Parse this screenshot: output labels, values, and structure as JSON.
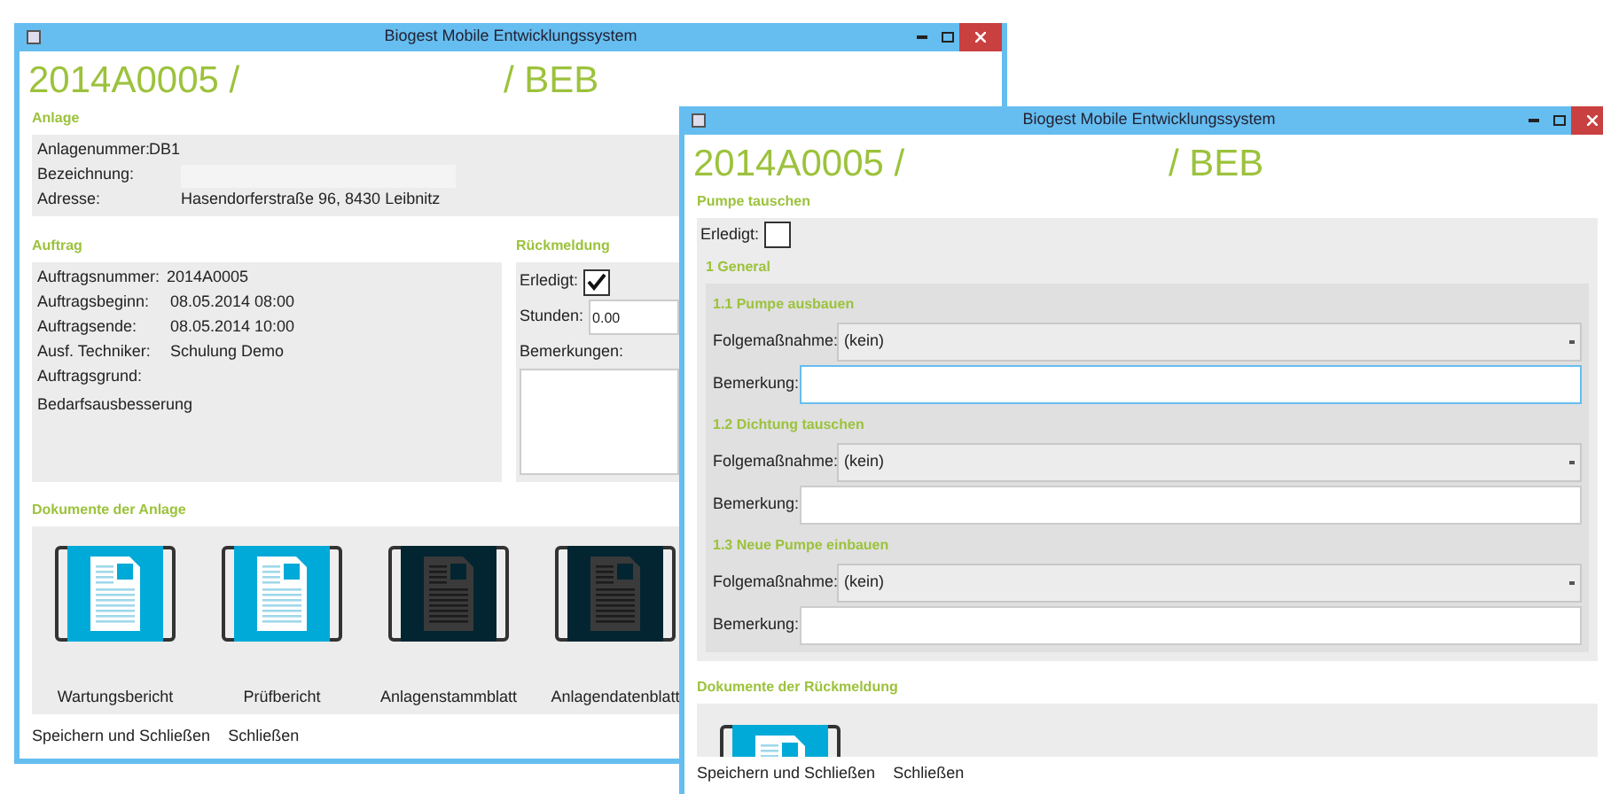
{
  "main_window": {
    "title": "Biogest Mobile Entwicklungssystem",
    "heading_left": "2014A0005 /",
    "heading_right": "/ BEB",
    "anlage": {
      "label": "Anlage",
      "rows": [
        {
          "label": "Anlagenummer:",
          "value": "DB1"
        },
        {
          "label": "Bezeichnung:"
        },
        {
          "label": "Adresse:",
          "value": "Hasendorferstraße 96, 8430 Leibnitz"
        }
      ]
    },
    "auftrag": {
      "label": "Auftrag",
      "rows": [
        {
          "label": "Auftragsnummer:",
          "value": "2014A0005"
        },
        {
          "label": "Auftragsbeginn:",
          "value": "08.05.2014 08:00"
        },
        {
          "label": "Auftragsende:",
          "value": "08.05.2014 10:00"
        },
        {
          "label": "Ausf. Techniker:",
          "value": "Schulung Demo"
        },
        {
          "label": "Auftragsgrund:"
        }
      ],
      "note": "Bedarfsausbesserung"
    },
    "rueckmeldung": {
      "label": "Rückmeldung",
      "done_label": "Erledigt:",
      "checked": true,
      "hours_label": "Stunden:",
      "hours_value": "0.00",
      "remarks_label": "Bemerkungen:"
    },
    "documents": {
      "label": "Dokumente der Anlage",
      "items": [
        {
          "name": "Wartungsbericht",
          "kind": "blue"
        },
        {
          "name": "Prüfbericht",
          "kind": "blue"
        },
        {
          "name": "Anlagenstammblatt",
          "kind": "dark"
        },
        {
          "name": "Anlagendatenblatt",
          "kind": "dark"
        }
      ]
    },
    "footer_buttons": [
      "Speichern und Schließen",
      "Schließen"
    ]
  },
  "detail_window": {
    "title": "Biogest Mobile Entwicklungssystem",
    "heading_left": "2014A0005 /",
    "heading_right": "/ BEB",
    "task": {
      "label": "Pumpe tauschen",
      "done_label": "Erledigt:",
      "checked": false,
      "group": {
        "label": "1 General",
        "steps": [
          {
            "title": "1.1 Pumpe ausbauen",
            "followup_label": "Folgemaßnahme:",
            "followup_value": "(kein)",
            "remark_label": "Bemerkung:"
          },
          {
            "title": "1.2 Dichtung tauschen",
            "followup_label": "Folgemaßnahme:",
            "followup_value": "(kein)",
            "remark_label": "Bemerkung:"
          },
          {
            "title": "1.3 Neue Pumpe einbauen",
            "followup_label": "Folgemaßnahme:",
            "followup_value": "(kein)",
            "remark_label": "Bemerkung:"
          }
        ]
      }
    },
    "documents": {
      "label": "Dokumente der Rückmeldung",
      "items": [
        {
          "kind": "blue"
        }
      ]
    },
    "footer_buttons": [
      "Speichern und Schließen",
      "Schließen"
    ]
  }
}
